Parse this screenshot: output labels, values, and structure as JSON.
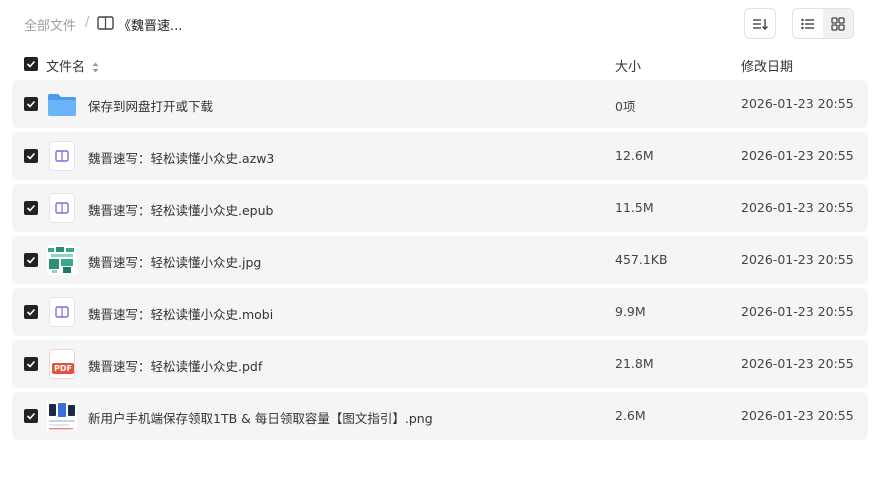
{
  "breadcrumb": {
    "root": "全部文件",
    "separator": "/",
    "current": "《魏晋速..."
  },
  "toolbar": {
    "sort_icon": "sort-icon",
    "list_view_icon": "list-view-icon",
    "grid_view_icon": "grid-view-icon"
  },
  "header": {
    "name": "文件名",
    "size": "大小",
    "modified": "修改日期"
  },
  "files": [
    {
      "name": "保存到网盘打开或下载",
      "size": "0项",
      "date": "2026-01-23 20:55",
      "icon": "folder-icon"
    },
    {
      "name": "魏晋速写：轻松读懂小众史.azw3",
      "size": "12.6M",
      "date": "2026-01-23 20:55",
      "icon": "ebook-icon"
    },
    {
      "name": "魏晋速写：轻松读懂小众史.epub",
      "size": "11.5M",
      "date": "2026-01-23 20:55",
      "icon": "ebook-icon"
    },
    {
      "name": "魏晋速写：轻松读懂小众史.jpg",
      "size": "457.1KB",
      "date": "2026-01-23 20:55",
      "icon": "image-thumbnail"
    },
    {
      "name": "魏晋速写：轻松读懂小众史.mobi",
      "size": "9.9M",
      "date": "2026-01-23 20:55",
      "icon": "ebook-icon"
    },
    {
      "name": "魏晋速写：轻松读懂小众史.pdf",
      "size": "21.8M",
      "date": "2026-01-23 20:55",
      "icon": "pdf-icon",
      "pdf_label": "PDF"
    },
    {
      "name": "新用户手机端保存领取1TB & 每日领取容量【图文指引】.png",
      "size": "2.6M",
      "date": "2026-01-23 20:55",
      "icon": "image-thumbnail"
    }
  ],
  "colors": {
    "row_bg": "#f5f5f6",
    "checkbox": "#222222",
    "folder": "#5aa7f5",
    "ebook_accent": "#7b6fd6",
    "pdf_red": "#e5533e"
  }
}
